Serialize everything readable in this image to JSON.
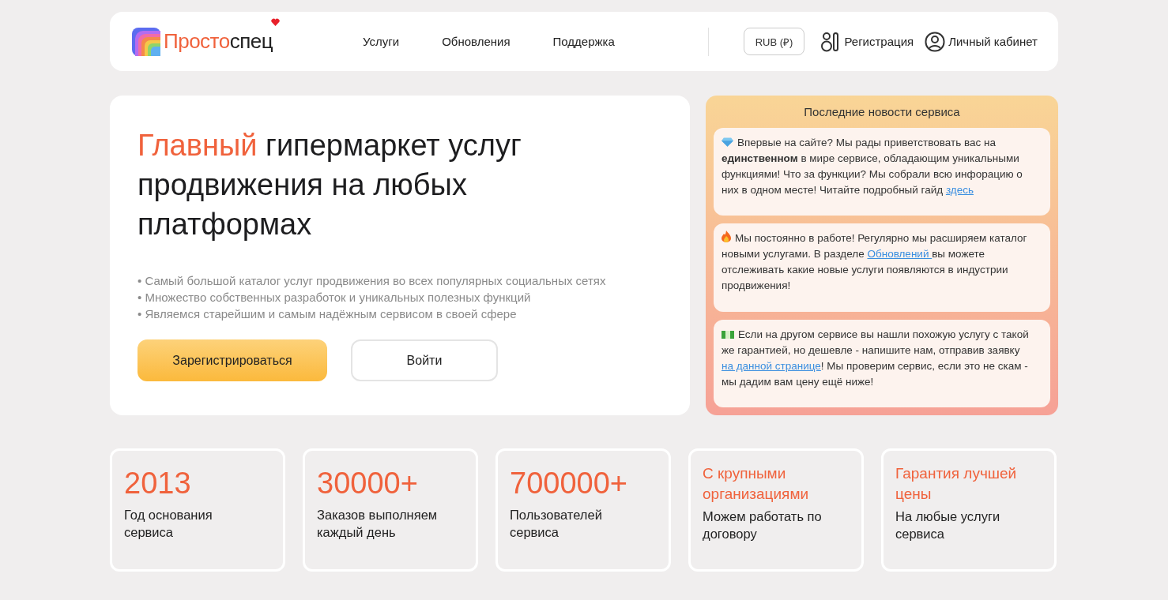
{
  "header": {
    "logo": {
      "accent": "Просто",
      "rest": "спец"
    },
    "nav": [
      "Услуги",
      "Обновления",
      "Поддержка"
    ],
    "currency": "RUB (₽)",
    "register": "Регистрация",
    "account": "Личный кабинет"
  },
  "hero": {
    "title_accent": "Главный",
    "title_rest": "гипермаркет услуг продвижения на любых платформах",
    "bullets": [
      "• Самый большой каталог услуг продвижения во всех популярных социальных сетях",
      "• Множество собственных разработок и уникальных полезных функций",
      "• Являемся старейшим и самым надёжным сервисом в своей сфере"
    ],
    "primary_button": "Зарегистрироваться",
    "secondary_button": "Войти"
  },
  "news": {
    "title": "Последние новости сервиса",
    "items": [
      {
        "kind": "gem",
        "text": "Впервые на сайте? Мы рады приветствовать вас на **единственном** в мире сервисе, обладающим уникальными функциями! Что за функции? Мы собрали всю инфорацию о них в одном месте! Читайте подробный гайд ",
        "link": "здесь"
      },
      {
        "kind": "fire",
        "text": "Мы постоянно в работе! Регулярно мы расширяем каталог новыми услугами. В разделе ",
        "link": "Обновлений ",
        "after": "вы можете отслеживать какие новые услуги появляются в индустрии продвижения!"
      },
      {
        "kind": "money",
        "text": "Если на другом сервисе вы нашли похожую услугу с такой же гарантией, но дешевле - напишите нам, отправив заявку ",
        "link": "на данной странице",
        "after": "! Мы проверим сервис, если это не скам - мы дадим вам цену ещё ниже!"
      }
    ]
  },
  "stats": [
    {
      "kind": "number",
      "headline": "2013",
      "caption": "Год основания сервиса"
    },
    {
      "kind": "number",
      "headline": "30000+",
      "caption": "Заказов выполняем каждый день"
    },
    {
      "kind": "number",
      "headline": "700000+",
      "caption": "Пользователей сервиса"
    },
    {
      "kind": "text",
      "headline": "С крупными организациями",
      "caption": "Можем работать по договору"
    },
    {
      "kind": "text",
      "headline": "Гарантия лучшей цены",
      "caption": "На любые услуги сервиса"
    }
  ]
}
